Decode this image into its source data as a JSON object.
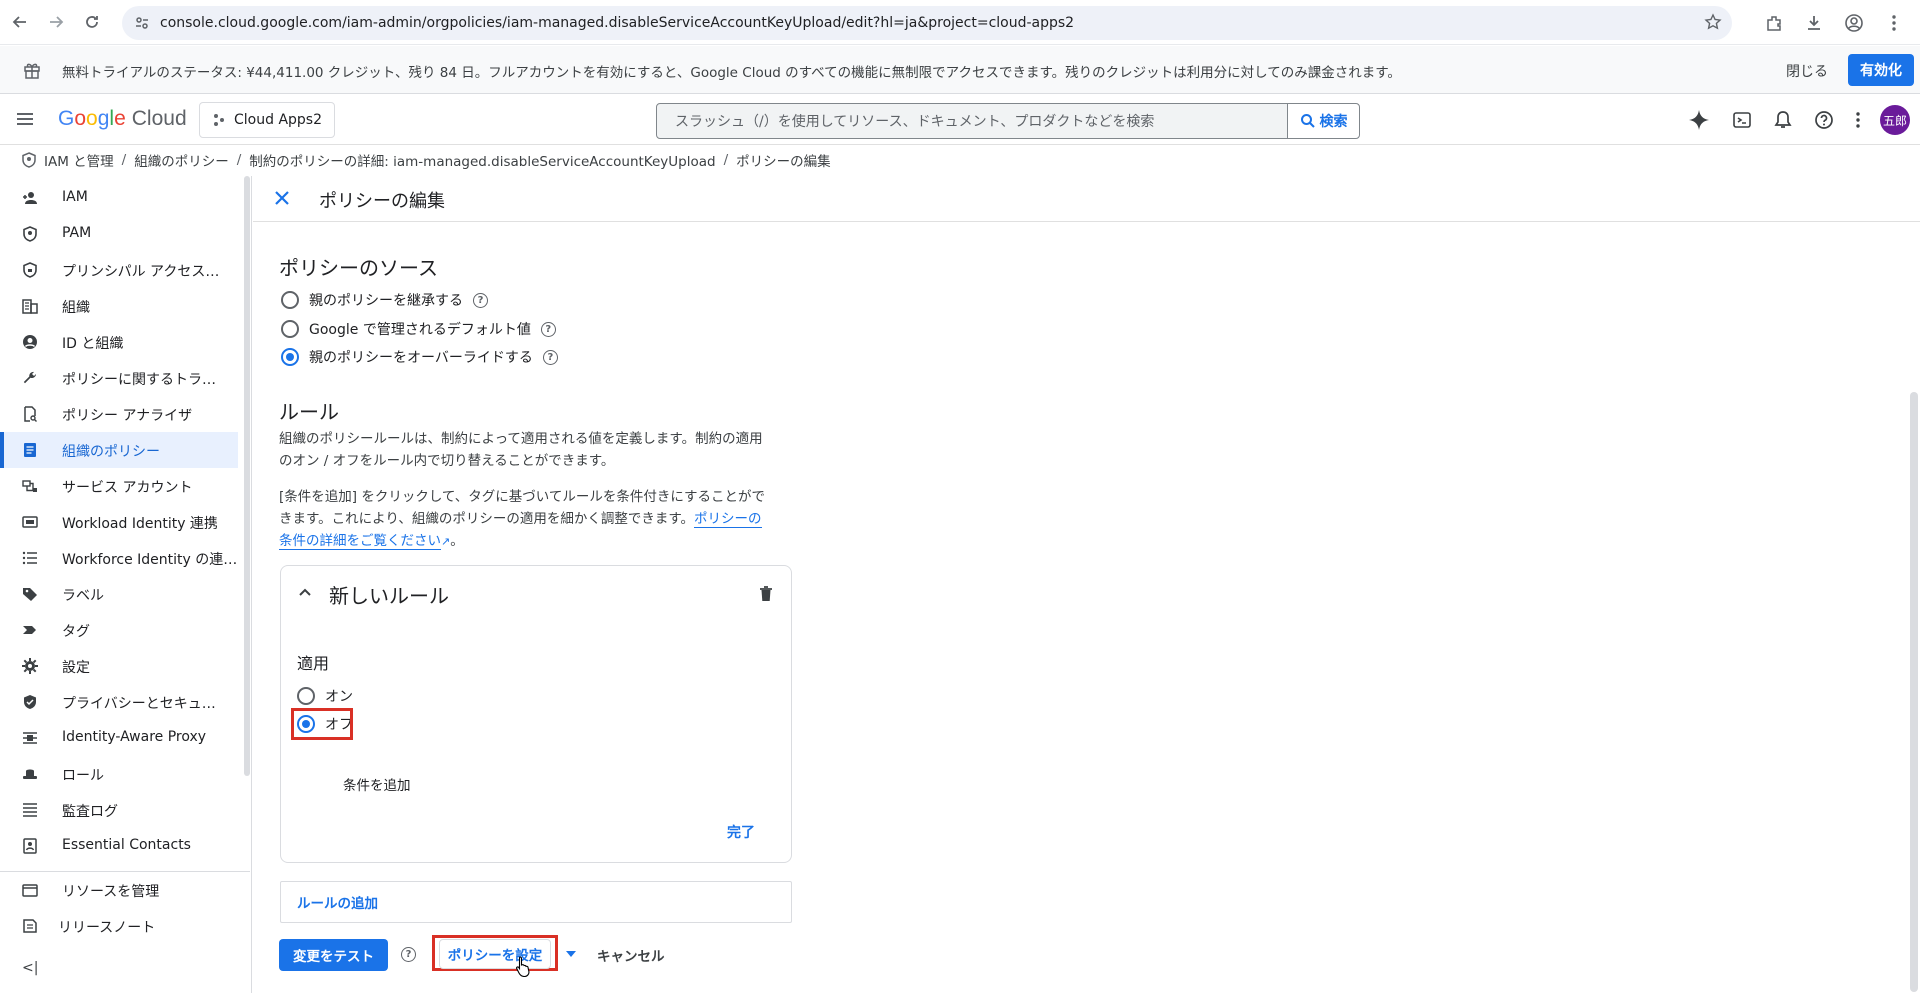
{
  "browser": {
    "url": "console.cloud.google.com/iam-admin/orgpolicies/iam-managed.disableServiceAccountKeyUpload/edit?hl=ja&project=cloud-apps2"
  },
  "trial": {
    "text": "無料トライアルのステータス: ¥44,411.00 クレジット、残り 84 日。フルアカウントを有効にすると、Google Cloud のすべての機能に無制限でアクセスできます。残りのクレジットは利用分に対してのみ課金されます。",
    "close": "閉じる",
    "activate": "有効化"
  },
  "header": {
    "logo_g": [
      "G",
      "o",
      "o",
      "g",
      "l",
      "e"
    ],
    "logo_cloud": "Cloud",
    "project": "Cloud Apps2",
    "search_placeholder": "スラッシュ（/）を使用してリソース、ドキュメント、プロダクトなどを検索",
    "search_button": "検索",
    "avatar": "五郎"
  },
  "breadcrumb": [
    "IAM と管理",
    "組織のポリシー",
    "制約のポリシーの詳細: iam-managed.disableServiceAccountKeyUpload",
    "ポリシーの編集"
  ],
  "sidebar": {
    "items": [
      {
        "label": "IAM",
        "icon": "person-add-icon"
      },
      {
        "label": "PAM",
        "icon": "shield-icon"
      },
      {
        "label": "プリンシパル アクセス…",
        "icon": "shield-lock-icon"
      },
      {
        "label": "組織",
        "icon": "building-icon"
      },
      {
        "label": "ID と組織",
        "icon": "account-circle-icon"
      },
      {
        "label": "ポリシーに関するトラ…",
        "icon": "wrench-icon"
      },
      {
        "label": "ポリシー アナライザ",
        "icon": "doc-search-icon"
      },
      {
        "label": "組織のポリシー",
        "icon": "list-doc-icon"
      },
      {
        "label": "サービス アカウント",
        "icon": "service-account-icon"
      },
      {
        "label": "Workload Identity 連携",
        "icon": "id-card-icon"
      },
      {
        "label": "Workforce Identity の連…",
        "icon": "list-icon"
      },
      {
        "label": "ラベル",
        "icon": "label-icon"
      },
      {
        "label": "タグ",
        "icon": "tag-icon"
      },
      {
        "label": "設定",
        "icon": "gear-icon"
      },
      {
        "label": "プライバシーとセキュ…",
        "icon": "shield-check-icon"
      },
      {
        "label": "Identity-Aware Proxy",
        "icon": "proxy-icon"
      },
      {
        "label": "ロール",
        "icon": "hat-icon"
      },
      {
        "label": "監査ログ",
        "icon": "lines-icon"
      },
      {
        "label": "Essential Contacts",
        "icon": "contacts-icon"
      }
    ],
    "manage": "リソースを管理",
    "release_notes": "リリースノート",
    "collapse": "<|"
  },
  "main": {
    "title": "ポリシーの編集",
    "source_title": "ポリシーのソース",
    "source_options": [
      {
        "label": "親のポリシーを継承する",
        "checked": false
      },
      {
        "label": "Google で管理されるデフォルト値",
        "checked": false
      },
      {
        "label": "親のポリシーをオーバーライドする",
        "checked": true
      }
    ],
    "rules_title": "ルール",
    "rules_desc1_line1": "組織のポリシールールは、制約によって適用される値を定義します。制約の適用",
    "rules_desc1_line2": "のオン / オフをルール内で切り替えることができます。",
    "rules_desc2_line1": "[条件を追加] をクリックして、タグに基づいてルールを条件付きにすることがで",
    "rules_desc2_line2a": "きます。これにより、組織のポリシーの適用を細かく調整できます。",
    "rules_desc2_link1": "ポリシーの",
    "rules_desc2_link2": "条件の詳細をご覧ください",
    "rules_desc2_end": "。",
    "rule": {
      "title": "新しいルール",
      "apply_label": "適用",
      "on": "オン",
      "off": "オフ",
      "selected": "off",
      "add_condition": "条件を追加",
      "done": "完了"
    },
    "add_rule": "ルールの追加",
    "test_button": "変更をテスト",
    "set_policy_button": "ポリシーを設定",
    "cancel_button": "キャンセル"
  }
}
